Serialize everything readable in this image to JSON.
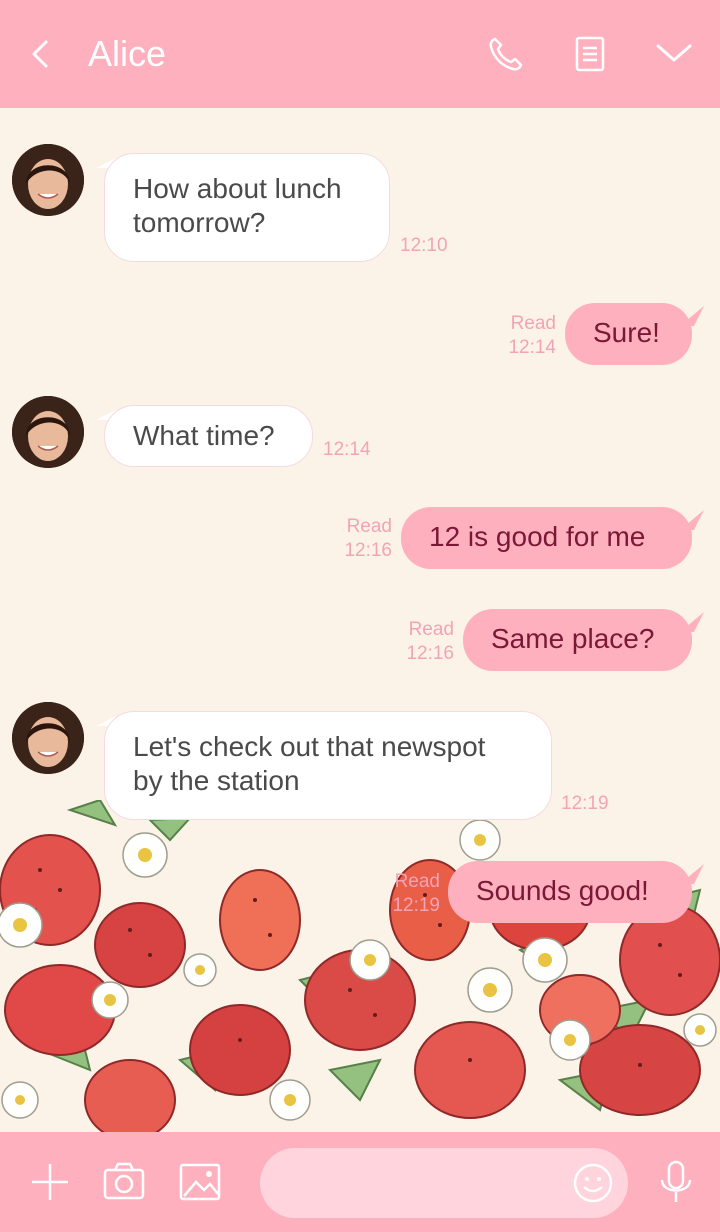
{
  "header": {
    "title": "Alice",
    "icons": [
      "back-icon",
      "phone-icon",
      "notes-icon",
      "chevron-down-icon"
    ]
  },
  "messages": [
    {
      "from": "Alice",
      "lines": [
        "How about lunch",
        "tomorrow?"
      ],
      "time": "12:10"
    },
    {
      "from": "me",
      "text": "Sure!",
      "read": "Read",
      "time": "12:14"
    },
    {
      "from": "Alice",
      "lines": [
        "What time?"
      ],
      "time": "12:14"
    },
    {
      "from": "me",
      "text": "12 is good for me",
      "read": "Read",
      "time": "12:16"
    },
    {
      "from": "me",
      "text": "Same place?",
      "read": "Read",
      "time": "12:16"
    },
    {
      "from": "Alice",
      "lines": [
        "Let's check out that newspot",
        "by the station"
      ],
      "time": "12:19"
    },
    {
      "from": "me",
      "text": "Sounds good!",
      "read": "Read",
      "time": "12:19"
    }
  ],
  "footer": {
    "icons": [
      "plus-icon",
      "camera-icon",
      "image-icon",
      "smile-icon",
      "microphone-icon"
    ],
    "input_value": ""
  },
  "colors": {
    "header_bg": "#ffb0bf",
    "chat_bg": "#fbf3e7",
    "outgoing_bubble": "#ffb0bf",
    "outgoing_text": "#7a1836",
    "meta_text": "#f4a3b6"
  }
}
